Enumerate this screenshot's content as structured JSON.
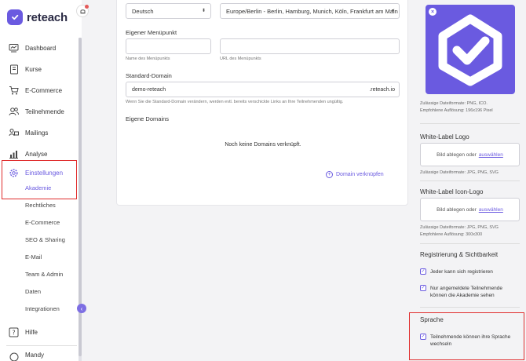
{
  "brand": {
    "name": "reteach",
    "accent": "#6a5ae0",
    "highlight": "#e02c2c"
  },
  "sidebar": {
    "items": [
      {
        "label": "Dashboard",
        "icon": "dashboard-icon"
      },
      {
        "label": "Kurse",
        "icon": "courses-icon"
      },
      {
        "label": "E-Commerce",
        "icon": "cart-icon"
      },
      {
        "label": "Teilnehmende",
        "icon": "users-icon"
      },
      {
        "label": "Mailings",
        "icon": "mailings-icon"
      },
      {
        "label": "Analyse",
        "icon": "analytics-icon"
      },
      {
        "label": "Einstellungen",
        "icon": "gear-icon"
      },
      {
        "label": "Hilfe",
        "icon": "help-icon"
      },
      {
        "label": "Mandy",
        "icon": "avatar-icon"
      }
    ],
    "subitems": [
      "Akademie",
      "Rechtliches",
      "E-Commerce",
      "SEO & Sharing",
      "E-Mail",
      "Team & Admin",
      "Daten",
      "Integrationen"
    ],
    "active_subitem": "Akademie"
  },
  "main": {
    "language_select": "Deutsch",
    "timezone_select": "Europe/Berlin - Berlin, Hamburg, Munich, Köln, Frankfurt am Main",
    "custom_menu": {
      "title": "Eigener Menüpunkt",
      "name_hint": "Name des Menüpunkts",
      "url_hint": "URL des Menüpunkts"
    },
    "standard_domain": {
      "title": "Standard-Domain",
      "value": "demo-reteach",
      "suffix": ".reteach.io",
      "hint": "Wenn Sie die Standard-Domain verändern, werden evtl. bereits verschickte Links an Ihre Teilnehmenden ungültig."
    },
    "custom_domains": {
      "title": "Eigene Domains",
      "empty": "Noch keine Domains verknüpft.",
      "link_button": "Domain verknüpfen"
    }
  },
  "right": {
    "favicon_hint_1": "Zulässige Dateiformate: PNG, ICO.",
    "favicon_hint_2": "Empfohlene Auflösung: 196x196 Pixel",
    "wl_logo": {
      "title": "White-Label Logo",
      "drop_text": "Bild ablegen oder",
      "drop_link": "auswählen",
      "hint": "Zulässige Dateiformate: JPG, PNG, SVG"
    },
    "wl_icon": {
      "title": "White-Label Icon-Logo",
      "drop_text": "Bild ablegen oder",
      "drop_link": "auswählen",
      "hint_1": "Zulässige Dateiformate: JPG, PNG, SVG",
      "hint_2": "Empfohlene Auflösung: 300x300"
    },
    "registration": {
      "title": "Registrierung & Sichtbarkeit",
      "option_1": "Jeder kann sich registrieren",
      "option_2a": "Nur angemeldete Teilnehmende",
      "option_2b": "können die Akademie sehen",
      "option_1_checked": true,
      "option_2_checked": true
    },
    "language": {
      "title": "Sprache",
      "option_a": "Teilnehmende können ihre Sprache",
      "option_b": "wechseln",
      "checked": true
    }
  }
}
